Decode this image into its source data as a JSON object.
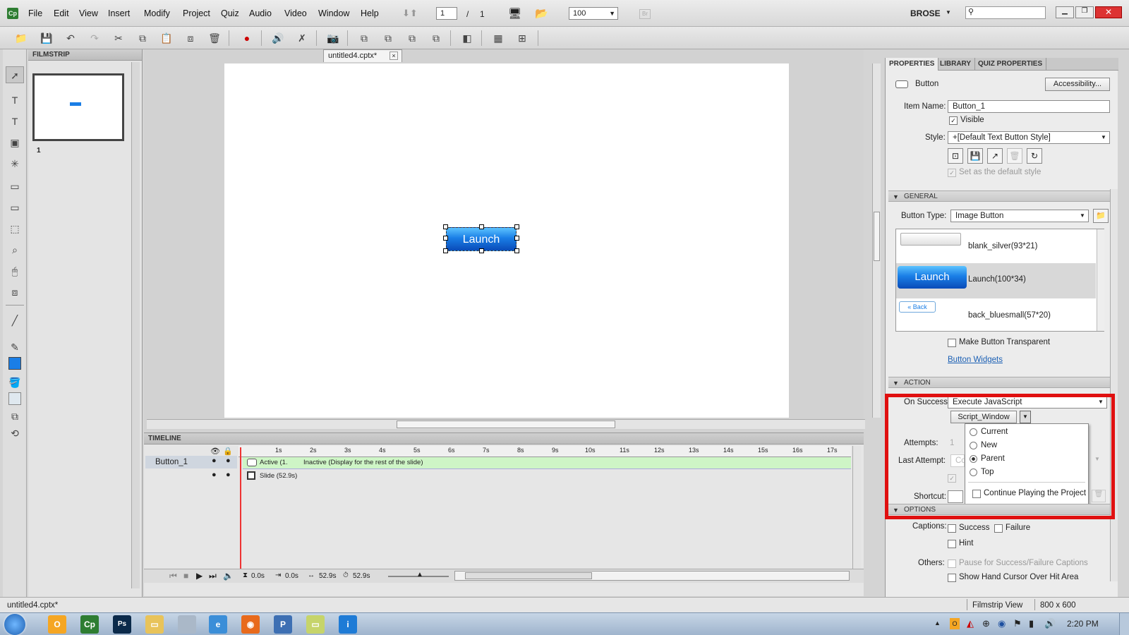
{
  "app": {
    "logo": "Cp"
  },
  "menu": [
    "File",
    "Edit",
    "View",
    "Insert",
    "Modify",
    "Project",
    "Quiz",
    "Audio",
    "Video",
    "Window",
    "Help"
  ],
  "nav": {
    "page": "1",
    "separator": "/",
    "total": "1",
    "zoom": "100",
    "user": "BROSE",
    "br": "Br"
  },
  "document": {
    "tab": "untitled4.cptx*",
    "close": "×"
  },
  "filmstrip": {
    "header": "FILMSTRIP",
    "slide_number": "1"
  },
  "stage": {
    "button_label": "Launch"
  },
  "timeline": {
    "header": "TIMELINE",
    "layers": [
      "Button_1"
    ],
    "ruler": [
      "1s",
      "2s",
      "3s",
      "4s",
      "5s",
      "6s",
      "7s",
      "8s",
      "9s",
      "10s",
      "11s",
      "12s",
      "13s",
      "14s",
      "15s",
      "16s",
      "17s"
    ],
    "row1_active": "Active (1.",
    "row1_inactive": "Inactive (Display for the rest of the slide)",
    "row2": "Slide (52.9s)",
    "footer": {
      "t1": "0.0s",
      "t2": "0.0s",
      "t3": "52.9s",
      "t4": "52.9s"
    }
  },
  "properties": {
    "tabs": [
      "PROPERTIES",
      "LIBRARY",
      "QUIZ PROPERTIES"
    ],
    "type": "Button",
    "accessibility": "Accessibility...",
    "item_name_label": "Item Name:",
    "item_name": "Button_1",
    "visible": "Visible",
    "style_label": "Style:",
    "style": "+[Default Text Button Style]",
    "default_style": "Set as the default style",
    "general": {
      "header": "GENERAL",
      "button_type_label": "Button Type:",
      "button_type": "Image Button",
      "images": [
        {
          "name": "blank_silver(93*21)"
        },
        {
          "name": "Launch(100*34)",
          "preview": "Launch"
        },
        {
          "name": "back_bluesmall(57*20)",
          "preview": "« Back"
        }
      ],
      "transparent": "Make Button Transparent",
      "widgets": "Button Widgets"
    },
    "action": {
      "header": "ACTION",
      "on_success_label": "On Success:",
      "on_success": "Execute JavaScript",
      "script_window": "Script_Window",
      "attempts_label": "Attempts:",
      "attempts_value": "1",
      "last_attempt_label": "Last Attempt:",
      "last_attempt_value": "Co",
      "shortcut_label": "Shortcut:",
      "window_options": [
        "Current",
        "New",
        "Parent",
        "Top"
      ],
      "selected_option": "Parent",
      "continue_playing": "Continue Playing the Project"
    },
    "options": {
      "header": "OPTIONS",
      "captions_label": "Captions:",
      "success": "Success",
      "failure": "Failure",
      "hint": "Hint",
      "others_label": "Others:",
      "pause": "Pause for Success/Failure Captions",
      "hand": "Show Hand Cursor Over Hit Area"
    }
  },
  "status": {
    "file": "untitled4.cptx*",
    "view": "Filmstrip View",
    "size": "800 x 600"
  },
  "taskbar": {
    "clock": "2:20 PM"
  },
  "colors": {
    "highlight": "#e01010",
    "accent": "#1a7ee6",
    "link": "#1a5fb4"
  }
}
